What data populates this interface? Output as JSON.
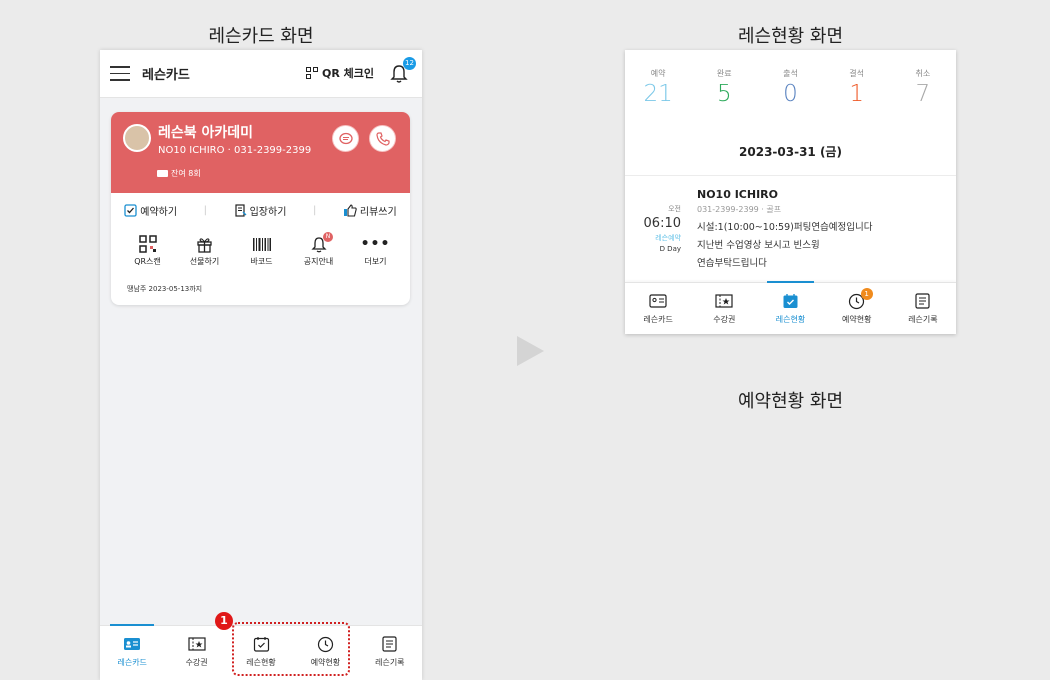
{
  "captions": {
    "lesson_card_screen": "레슨카드 화면",
    "lesson_status_screen": "레슨현황 화면",
    "reservation_status_screen": "예약현황 화면"
  },
  "left": {
    "topbar": {
      "title": "레슨카드",
      "qr_checkin": "QR 체크인",
      "bell_badge": "12"
    },
    "card": {
      "academy_name": "레슨북 아카데미",
      "academy_sub": "NO10 ICHIRO · 031-2399-2399",
      "remaining": "잔여 8회",
      "actions": [
        "예약하기",
        "입장하기",
        "리뷰쓰기"
      ],
      "icons": [
        "QR스캔",
        "선물하기",
        "바코드",
        "공지안내",
        "더보기"
      ],
      "notice_badge": "N",
      "expire_text": "땡남주 2023-05-13까지"
    },
    "nav": [
      "레슨카드",
      "수강권",
      "레슨현황",
      "예약현황",
      "레슨기록"
    ],
    "callout_number": "1"
  },
  "right": {
    "stats": [
      {
        "label": "예약",
        "value": "21",
        "color": "#7cc8e8"
      },
      {
        "label": "완료",
        "value": "5",
        "color": "#2eaa5c"
      },
      {
        "label": "출석",
        "value": "0",
        "color": "#5a83c0"
      },
      {
        "label": "결석",
        "value": "1",
        "color": "#ef5a28"
      },
      {
        "label": "취소",
        "value": "7",
        "color": "#a8a8a8"
      }
    ],
    "date": "2023-03-31 (금)",
    "lesson": {
      "ampm": "오전",
      "time": "06:10",
      "tag": "레슨예약",
      "dday": "D Day",
      "name": "NO10 ICHIRO",
      "sub": "031-2399-2399 · 골프",
      "line1": "시설:1(10:00~10:59)퍼팅연습예정입니다",
      "line2": "지난번 수업영상 보시고 빈스윙",
      "line3": "연습부탁드립니다"
    },
    "nav": [
      "레슨카드",
      "수강권",
      "레슨현황",
      "예약현황",
      "레슨기록"
    ],
    "reservation_badge": "1"
  }
}
